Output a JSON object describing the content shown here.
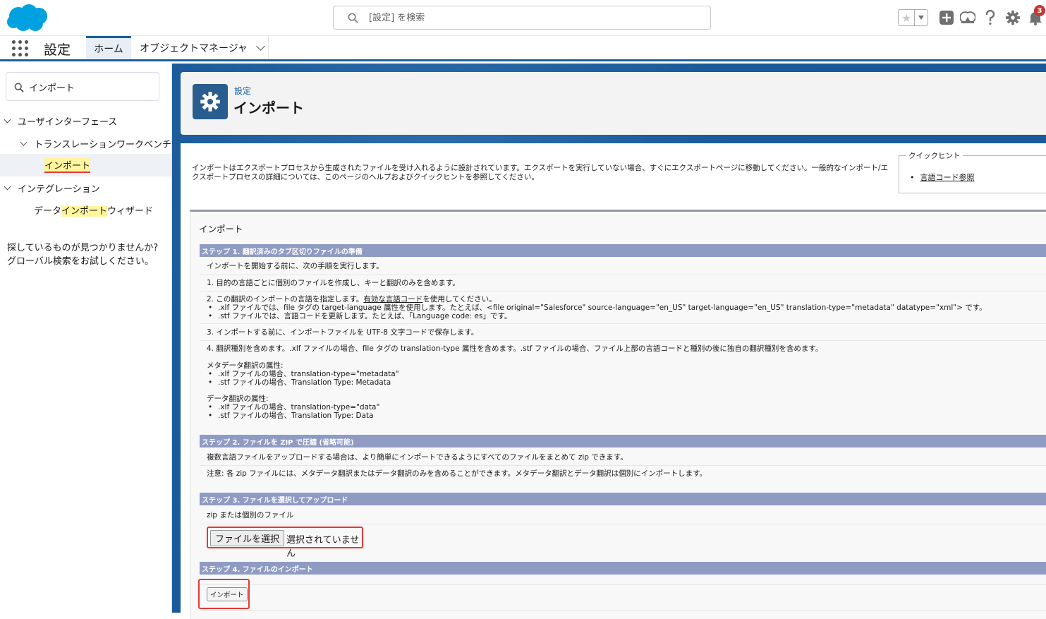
{
  "header": {
    "search_placeholder": "[設定] を検索",
    "notification_count": "3"
  },
  "nav": {
    "app_name": "設定",
    "tabs": [
      {
        "label": "ホーム",
        "active": true
      },
      {
        "label": "オブジェクトマネージャ",
        "has_dropdown": true
      }
    ]
  },
  "sidebar": {
    "quick_find_value": "インポート",
    "tree": {
      "item1": "ユーザインターフェース",
      "item2": "トランスレーションワークベンチ",
      "item3": "インポート",
      "item4": "インテグレーション",
      "item5_prefix": "データ",
      "item5_highlight": "インポート",
      "item5_suffix": "ウィザード"
    },
    "help_text": "探しているものが見つかりませんか? グローバル検索をお試しください。"
  },
  "page_header": {
    "breadcrumb": "設定",
    "title": "インポート"
  },
  "intro_text": "インポートはエクスポートプロセスから生成されたファイルを受け入れるように設計されています。エクスポートを実行していない場合、すぐにエクスポートページに移動してください。一般的なインポート/エクスポートプロセスの詳細については、このページのヘルプおよびクイックヒントを参照してください。",
  "quick_hints": {
    "legend": "クイックヒント",
    "link": "言語コード参照"
  },
  "import_section": {
    "title": "インポート",
    "step1": {
      "header": "ステップ 1. 翻訳済みのタブ区切りファイルの準備",
      "intro": "インポートを開始する前に、次の手順を実行します。",
      "s1": "1. 目的の言語ごとに個別のファイルを作成し、キーと翻訳のみを含めます。",
      "s2_prefix": "2. この翻訳のインポートの言語を指定します。",
      "s2_link": "有効な言語コード",
      "s2_suffix": "を使用してください。",
      "s2_b1": ".xlf ファイルでは、file タグの target-language 属性を使用します。たとえば、<file original=\"Salesforce\" source-language=\"en_US\" target-language=\"en_US\" translation-type=\"metadata\" datatype=\"xml\"> です。",
      "s2_b2": ".stf ファイルでは、言語コードを更新します。たとえば、「Language code: es」です。",
      "s3": "3. インポートする前に、インポートファイルを UTF-8 文字コードで保存します。",
      "s4": "4. 翻訳種別を含めます。.xlf ファイルの場合、file タグの translation-type 属性を含めます。.stf ファイルの場合、ファイル上部の言語コードと種別の後に独自の翻訳種別を含めます。",
      "meta_title": "メタデータ翻訳の属性:",
      "meta_b1": ".xlf ファイルの場合、translation-type=\"metadata\"",
      "meta_b2": ".stf ファイルの場合、Translation Type: Metadata",
      "data_title": "データ翻訳の属性:",
      "data_b1": ".xlf ファイルの場合、translation-type=\"data\"",
      "data_b2": ".stf ファイルの場合、Translation Type: Data"
    },
    "step2": {
      "header": "ステップ 2. ファイルを ZIP で圧縮 (省略可能)",
      "line1": "複数言語ファイルをアップロードする場合は、より簡単にインポートできるようにすべてのファイルをまとめて zip できます。",
      "line2": "注意: 各 zip ファイルには、メタデータ翻訳またはデータ翻訳のみを含めることができます。メタデータ翻訳とデータ翻訳は個別にインポートします。"
    },
    "step3": {
      "header": "ステップ 3. ファイルを選択してアップロード",
      "label": "zip または個別のファイル",
      "button": "ファイルを選択",
      "status": "選択されていません"
    },
    "step4": {
      "header": "ステップ 4. ファイルのインポート",
      "button": "インポート"
    }
  }
}
